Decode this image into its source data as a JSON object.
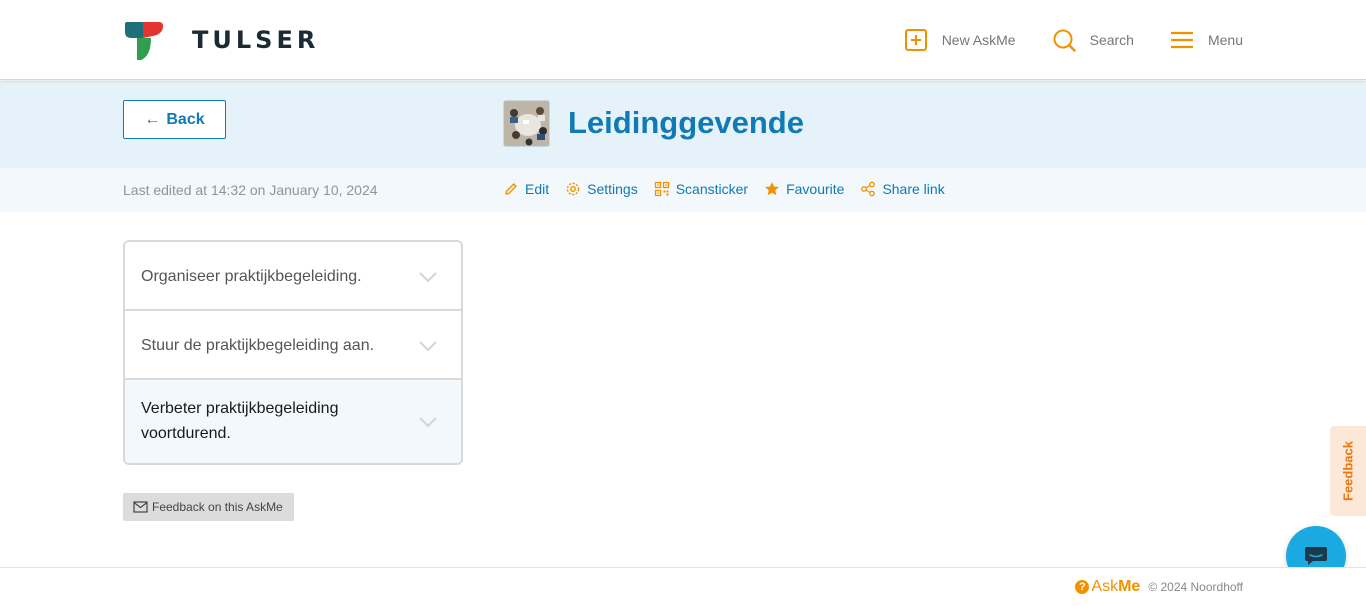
{
  "brand": {
    "name": "TULSER",
    "colors": {
      "red": "#e3342f",
      "green": "#2e9e4f",
      "teal": "#1d6f7a"
    }
  },
  "nav": {
    "new_askme": {
      "label": "New AskMe",
      "icon": "plus-square-icon"
    },
    "search": {
      "label": "Search",
      "icon": "search-icon"
    },
    "menu": {
      "label": "Menu",
      "icon": "hamburger-icon"
    }
  },
  "back": {
    "label": "Back",
    "arrow": "←"
  },
  "page": {
    "title": "Leidinggevende",
    "last_edited": "Last edited at 14:32 on January 10, 2024"
  },
  "actions": {
    "edit": "Edit",
    "settings": "Settings",
    "scansticker": "Scansticker",
    "favourite": "Favourite",
    "share": "Share link"
  },
  "accordion": [
    {
      "text": "Organiseer praktijkbegeleiding."
    },
    {
      "text": "Stuur de praktijkbegeleiding aan."
    },
    {
      "text": "Verbeter praktijkbegeleiding voortdurend."
    }
  ],
  "feedback_button": "Feedback on this AskMe",
  "side_feedback": "Feedback",
  "footer": {
    "brand_ask": "Ask",
    "brand_me": "Me",
    "brand_q": "?",
    "copyright": "© 2024 Noordhoff"
  },
  "colors": {
    "primary": "#0f7ab4",
    "accent": "#f39200",
    "band": "#e5f2f9",
    "chat": "#1ba9e1"
  }
}
